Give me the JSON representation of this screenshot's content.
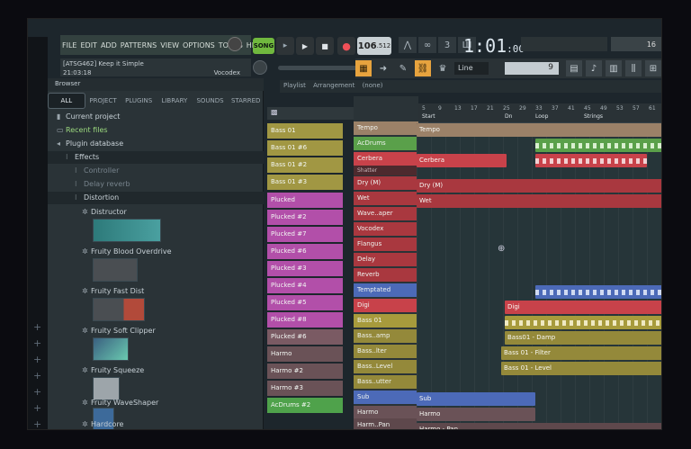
{
  "menu": [
    "FILE",
    "EDIT",
    "ADD",
    "PATTERNS",
    "VIEW",
    "OPTIONS",
    "TOOLS",
    "HELP"
  ],
  "hint": {
    "line1": "[ATSG462] Keep it Simple",
    "line2": "21:03:18",
    "plugin": "Vocodex"
  },
  "transport": {
    "mode": "SONG",
    "tempo": "106",
    "tempo_frac": ".512"
  },
  "clock": {
    "main": "1:01",
    "sub": ":00"
  },
  "meter_value": "16",
  "toolbar2": {
    "line_label": "Line",
    "number": "9"
  },
  "browser": {
    "title": "Browser",
    "tabs": [
      "ALL",
      "PROJECT",
      "PLUGINS",
      "LIBRARY",
      "SOUNDS",
      "STARRED"
    ],
    "items": [
      "Current project",
      "Recent files",
      "Plugin database",
      "Effects",
      "Controller",
      "Delay reverb",
      "Distortion",
      "Distructor",
      "Fruity Blood Overdrive",
      "Fruity Fast Dist",
      "Fruity Soft Clipper",
      "Fruity Squeeze",
      "Fruity WaveShaper",
      "Hardcore"
    ]
  },
  "channels": [
    "Bass 01",
    "Bass 01 #6",
    "Bass 01 #2",
    "Bass 01 #3",
    "Plucked",
    "Plucked #2",
    "Plucked #7",
    "Plucked #6",
    "Plucked #3",
    "Plucked #4",
    "Plucked #5",
    "Plucked #8",
    "Plucked #6",
    "Harmo",
    "Harmo #2",
    "Harmo #3",
    "AcDrums #2"
  ],
  "playlist_title": [
    "Playlist",
    "Arrangement",
    "(none)"
  ],
  "ruler_numbers": [
    "5",
    "9",
    "13",
    "17",
    "21",
    "25",
    "29",
    "33",
    "37",
    "41",
    "45",
    "49",
    "53",
    "57",
    "61"
  ],
  "markers": [
    "Start",
    "Dn",
    "Loop",
    "Strings"
  ],
  "tracks": [
    "Tempo",
    "AcDrums",
    "Cerbera",
    "Shatter",
    "Dry (M)",
    "Wet",
    "Wave..aper",
    "Vocodex",
    "Flangus",
    "Delay",
    "Reverb",
    "Temptated",
    "Digi",
    "Bass 01",
    "Bass..amp",
    "Bass..lter",
    "Bass..Level",
    "Bass..utter",
    "Sub",
    "Harmo",
    "Harm..Pan"
  ],
  "clips": [
    "Tempo",
    "Cerbera",
    "Dry (M)",
    "Wet",
    "Digi",
    "Bass01 - Damp",
    "Bass 01 - Filter",
    "Bass 01 - Level",
    "Sub",
    "Harmo",
    "Harmo - Pan"
  ],
  "colors": {
    "clip_red": "#c8424a",
    "clip_green": "#5aa04a",
    "clip_olive": "#a79b3c",
    "clip_blue": "#4c6ab8",
    "clip_tan": "#9b8168",
    "clip_mauve": "#7a5a63"
  }
}
